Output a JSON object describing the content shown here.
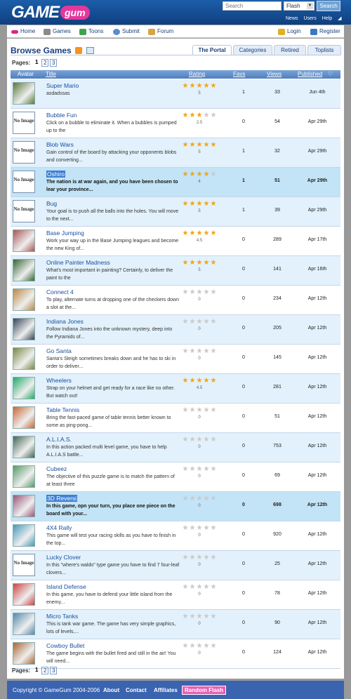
{
  "header": {
    "logo": {
      "part1": "GAME",
      "part2": "gum"
    },
    "search_placeholder": "Search",
    "search_type": "Flash",
    "search_button": "Search",
    "links": [
      "News",
      "Users",
      "Help"
    ]
  },
  "nav": {
    "home": "Home",
    "games": "Games",
    "toons": "Toons",
    "submit": "Submit",
    "forum": "Forum",
    "login": "Login",
    "register": "Register"
  },
  "page": {
    "title": "Browse Games",
    "tabs": [
      "The Portal",
      "Categories",
      "Retired",
      "Toplists"
    ],
    "pages_label": "Pages:",
    "pages": [
      "1",
      "2",
      "3"
    ]
  },
  "table": {
    "columns": {
      "avatar": "Avatar",
      "title": "Title",
      "rating": "Rating",
      "favs": "Favs",
      "views": "Views",
      "published": "Published"
    },
    "no_image": "No Image",
    "rows": [
      {
        "title": "Super Mario",
        "desc": "asdadssas",
        "stars": 5,
        "rating": "5",
        "favs": "1",
        "views": "33",
        "date": "Jun 4th",
        "thumb": "img"
      },
      {
        "title": "Bubble Fun",
        "desc": "Click on a bubble to eliminate it. When a bubbles is pumped up to the",
        "stars": 2.5,
        "rating": "2.5",
        "favs": "0",
        "views": "54",
        "date": "Apr 29th",
        "thumb": "none"
      },
      {
        "title": "Blob Wars",
        "desc": "Gain control of the board by attacking your opponents blobs and converting...",
        "stars": 5,
        "rating": "5",
        "favs": "1",
        "views": "32",
        "date": "Apr 29th",
        "thumb": "none"
      },
      {
        "title": "Oshiro",
        "desc": "The nation is at war again, and you have been chosen to lear your province...",
        "stars": 4,
        "rating": "4",
        "favs": "1",
        "views": "51",
        "date": "Apr 29th",
        "thumb": "none"
      },
      {
        "title": "Bug",
        "desc": "Your goal is to push all the balls into the holes. You will move to the next...",
        "stars": 5,
        "rating": "5",
        "favs": "1",
        "views": "39",
        "date": "Apr 29th",
        "thumb": "none"
      },
      {
        "title": "Base Jumping",
        "desc": "Work your way up in the Base Jumping leagues and become the new King of...",
        "stars": 4.5,
        "rating": "4.5",
        "favs": "0",
        "views": "289",
        "date": "Apr 17th",
        "thumb": "img"
      },
      {
        "title": "Online Painter Madness",
        "desc": "What's most important in painting? Certainly, to deliver the paint to the",
        "stars": 5,
        "rating": "5",
        "favs": "0",
        "views": "141",
        "date": "Apr 16th",
        "thumb": "img"
      },
      {
        "title": "Connect 4",
        "desc": "To play, alternate turns at dropping one of the checkers down a slot at the...",
        "stars": 0,
        "rating": "0",
        "favs": "0",
        "views": "234",
        "date": "Apr 12th",
        "thumb": "img"
      },
      {
        "title": "Indiana Jones",
        "desc": "Follow Indiana Jones into the unknown mystery, deep into the Pyramids of...",
        "stars": 0,
        "rating": "0",
        "favs": "0",
        "views": "205",
        "date": "Apr 12th",
        "thumb": "img"
      },
      {
        "title": "Go Santa",
        "desc": "Santa's Sleigh sometimes breaks down and he has to ski in order to deliver...",
        "stars": 0,
        "rating": "0",
        "favs": "0",
        "views": "145",
        "date": "Apr 12th",
        "thumb": "img"
      },
      {
        "title": "Wheelers",
        "desc": "Strap on your helmet and get ready for a race like no other. But watch out!",
        "stars": 4.5,
        "rating": "4.5",
        "favs": "0",
        "views": "281",
        "date": "Apr 12th",
        "thumb": "img"
      },
      {
        "title": "Table Tennis",
        "desc": "Bring the fast-paced game of table tennis better known to some as ping-pong...",
        "stars": 0,
        "rating": "0",
        "favs": "0",
        "views": "51",
        "date": "Apr 12th",
        "thumb": "img"
      },
      {
        "title": "A.L.I.A.S.",
        "desc": "In this action packed multi level game, you have to help A.L.I.A.S battle...",
        "stars": 0,
        "rating": "0",
        "favs": "0",
        "views": "753",
        "date": "Apr 12th",
        "thumb": "img"
      },
      {
        "title": "Cubeez",
        "desc": "The objective of this puzzle game is to match the pattern of at least three",
        "stars": 0,
        "rating": "0",
        "favs": "0",
        "views": "69",
        "date": "Apr 12th",
        "thumb": "img"
      },
      {
        "title": "3D Reversi",
        "desc": "In this game, opn your turn, you place one piece on the board with your...",
        "stars": 0,
        "rating": "0",
        "favs": "0",
        "views": "698",
        "date": "Apr 12th",
        "thumb": "img"
      },
      {
        "title": "4X4 Rally",
        "desc": "This game will test your racing skills as you have to finish in the top...",
        "stars": 0,
        "rating": "0",
        "favs": "0",
        "views": "920",
        "date": "Apr 12th",
        "thumb": "img"
      },
      {
        "title": "Lucky Clover",
        "desc": "In this \"where's waldo\" type game you have to find 7 four-leaf clovers...",
        "stars": 0,
        "rating": "0",
        "favs": "0",
        "views": "25",
        "date": "Apr 12th",
        "thumb": "none"
      },
      {
        "title": "Island Defense",
        "desc": "In this game, you have to defend your little island from the enemy...",
        "stars": 0,
        "rating": "0",
        "favs": "0",
        "views": "78",
        "date": "Apr 12th",
        "thumb": "img"
      },
      {
        "title": "Micro Tanks",
        "desc": "This is tank war game. The game has very simple graphics, lots of levels,...",
        "stars": 0,
        "rating": "0",
        "favs": "0",
        "views": "90",
        "date": "Apr 12th",
        "thumb": "img"
      },
      {
        "title": "Cowboy Bullet",
        "desc": "The game begins with the bullet fired and still in the air! You will need...",
        "stars": 0,
        "rating": "0",
        "favs": "0",
        "views": "124",
        "date": "Apr 12th",
        "thumb": "img"
      }
    ]
  },
  "footer": {
    "copyright": "Copyright © GameGum 2004-2006",
    "about": "About",
    "contact": "Contact",
    "affiliates": "Affiliates",
    "random": "Random Flash"
  },
  "colors": {
    "header": "#1c5ea9",
    "link": "#1a4fa0",
    "star": "#f3a414",
    "row_alt": "#e2f1fb",
    "footer": "#3a63b0"
  }
}
